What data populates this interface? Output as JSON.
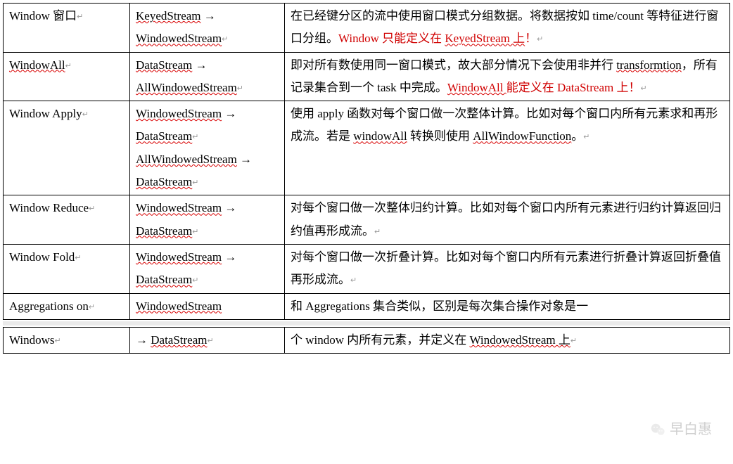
{
  "rows": [
    {
      "name": "Window 窗口",
      "trans_segs": [
        {
          "t": "KeyedStream",
          "spell": true
        },
        {
          "t": " → "
        },
        {
          "t": "WindowedStream",
          "spell": true
        }
      ],
      "trans_pmark": "↵",
      "desc_segs": [
        {
          "t": "在已经键分区的流中使用窗口模式分组数据。将数据按如 time/count 等特征进行窗口分组。"
        },
        {
          "t": "Window 只能定义在 ",
          "red": true
        },
        {
          "t": "KeyedStream 上",
          "red": true,
          "spell": true
        },
        {
          "t": "！",
          "red": true
        },
        {
          "t": "↵",
          "pmark": true
        }
      ]
    },
    {
      "name": "WindowAll",
      "name_spell": true,
      "trans_segs": [
        {
          "t": "DataStream",
          "spell": true
        },
        {
          "t": " → "
        },
        {
          "t": "AllWindowedStream",
          "spell": true
        }
      ],
      "trans_pmark": "↵",
      "desc_segs": [
        {
          "t": "即对所有数使用同一窗口模式，故大部分情况下会使用非并行 "
        },
        {
          "t": "transformtion",
          "spell": true
        },
        {
          "t": "，所有记录集合到一个 task 中完成。"
        },
        {
          "t": "WindowAll ",
          "red": true,
          "spell": true
        },
        {
          "t": "能定义在 DataStream 上！",
          "red": true
        },
        {
          "t": "↵",
          "pmark": true
        }
      ]
    },
    {
      "name": "Window Apply",
      "trans_lines": [
        [
          {
            "t": "WindowedStream",
            "spell": true
          },
          {
            "t": " → "
          },
          {
            "t": "DataStream",
            "spell": true
          }
        ],
        [
          {
            "t": "AllWindowedStream",
            "spell": true
          },
          {
            "t": " → "
          },
          {
            "t": "DataStream",
            "spell": true
          }
        ]
      ],
      "desc_segs": [
        {
          "t": "使用 apply 函数对每个窗口做一次整体计算。比如对每个窗口内所有元素求和再形成流。若是 "
        },
        {
          "t": "windowAll",
          "spell": true
        },
        {
          "t": " 转换则使用 "
        },
        {
          "t": "AllWindowFunction",
          "spell": true
        },
        {
          "t": "。"
        },
        {
          "t": "↵",
          "pmark": true
        }
      ]
    },
    {
      "name": "Window Reduce",
      "trans_segs": [
        {
          "t": "WindowedStream",
          "spell": true
        },
        {
          "t": " → "
        },
        {
          "t": "DataStream",
          "spell": true
        }
      ],
      "trans_pmark": "↵",
      "desc_segs": [
        {
          "t": "对每个窗口做一次整体归约计算。比如对每个窗口内所有元素进行归约计算返回归约值再形成流。"
        },
        {
          "t": "↵",
          "pmark": true
        }
      ]
    },
    {
      "name": "Window Fold",
      "trans_segs": [
        {
          "t": "WindowedStream",
          "spell": true
        },
        {
          "t": " → "
        },
        {
          "t": "DataStream",
          "spell": true
        }
      ],
      "trans_pmark": "↵",
      "desc_segs": [
        {
          "t": "对每个窗口做一次折叠计算。比如对每个窗口内所有元素进行折叠计算返回折叠值再形成流。"
        },
        {
          "t": "↵",
          "pmark": true
        }
      ]
    },
    {
      "name": "Aggregations on",
      "trans_segs": [
        {
          "t": "WindowedStream",
          "spell": true
        }
      ],
      "desc_segs": [
        {
          "t": "和 Aggregations 集合类似，区别是每次集合操作对象是一"
        }
      ]
    }
  ],
  "afterGap": {
    "name": "Windows",
    "name_pmark": "↵",
    "trans_segs": [
      {
        "t": "→ "
      },
      {
        "t": "DataStream",
        "spell": true
      }
    ],
    "trans_pmark": "↵",
    "desc_segs": [
      {
        "t": "个 window 内所有元素，并定义在 "
      },
      {
        "t": "WindowedStream 上",
        "spell": true
      },
      {
        "t": "↵",
        "pmark": true
      }
    ]
  },
  "watermark": "早白惠"
}
